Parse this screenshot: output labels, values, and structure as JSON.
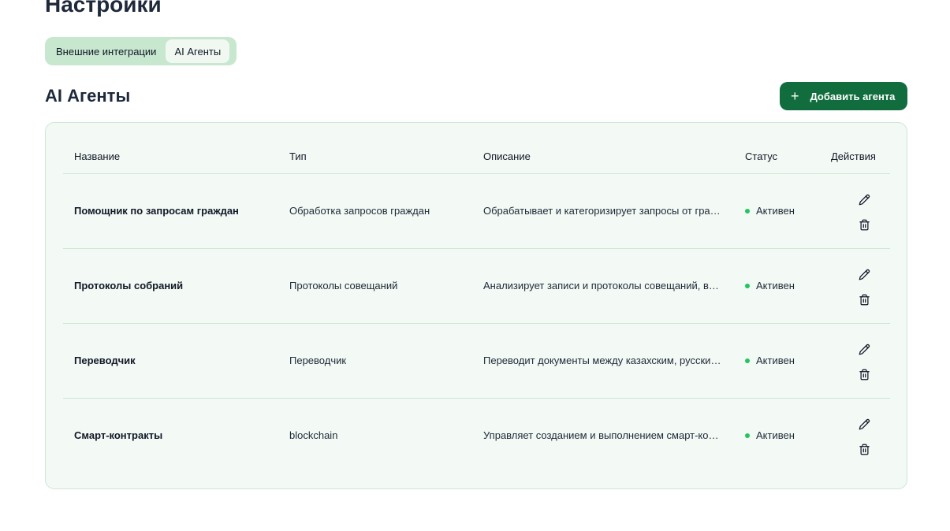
{
  "page": {
    "title": "Настройки"
  },
  "tabs": [
    {
      "label": "Внешние интеграции",
      "active": false
    },
    {
      "label": "AI Агенты",
      "active": true
    }
  ],
  "section": {
    "title": "AI Агенты",
    "add_button_label": "Добавить агента",
    "add_button_icon": "plus-icon"
  },
  "table": {
    "headers": {
      "name": "Название",
      "type": "Тип",
      "description": "Описание",
      "status": "Статус",
      "actions": "Действия"
    },
    "rows": [
      {
        "name": "Помощник по запросам граждан",
        "type": "Обработка запросов граждан",
        "description": "Обрабатывает и категоризирует запросы от граждан",
        "status": "Активен"
      },
      {
        "name": "Протоколы собраний",
        "type": "Протоколы совещаний",
        "description": "Анализирует записи и протоколы совещаний, выделяет решения",
        "status": "Активен"
      },
      {
        "name": "Переводчик",
        "type": "Переводчик",
        "description": "Переводит документы между казахским, русским и английским",
        "status": "Активен"
      },
      {
        "name": "Смарт-контракты",
        "type": "blockchain",
        "description": "Управляет созданием и выполнением смарт-контрактов",
        "status": "Активен"
      }
    ],
    "row_action_icons": [
      "pencil-icon",
      "trash-icon"
    ]
  },
  "colors": {
    "accent": "#116d3d",
    "tab_bg": "#c7e7cf",
    "card_bg": "#f3f9f4",
    "status_active": "#22c55e"
  }
}
